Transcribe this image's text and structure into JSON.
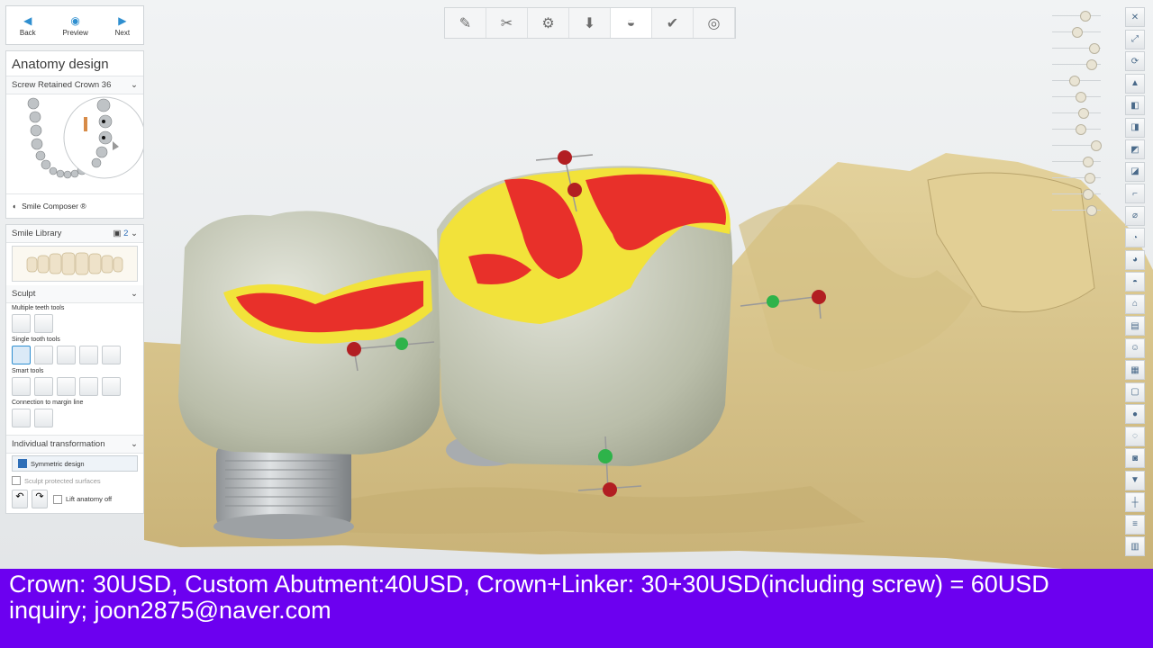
{
  "nav": {
    "back": "Back",
    "preview": "Preview",
    "next": "Next"
  },
  "panel": {
    "title": "Anatomy design",
    "restoration": "Screw Retained Crown 36",
    "smile_composer": "Smile Composer ®",
    "smile_library": "Smile Library",
    "library_badge": "2",
    "sculpt": "Sculpt",
    "multiple_tools": "Multiple teeth tools",
    "single_tools": "Single tooth tools",
    "smart_tools": "Smart tools",
    "connection": "Connection to margin line",
    "individual_transformation": "Individual transformation",
    "symmetric": "Symmetric design",
    "protected": "Sculpt protected surfaces",
    "lift_anatomy": "Lift anatomy off"
  },
  "top_toolbar": [
    "instrument-icon",
    "scissors-icon",
    "abutment-icon",
    "download-icon",
    "crown-icon",
    "check-crown-icon",
    "disc-icon"
  ],
  "right_slider_levels": [
    0.65,
    0.45,
    0.85,
    0.8,
    0.4,
    0.55,
    0.6,
    0.55,
    0.9,
    0.7,
    0.75,
    0.7,
    0.8
  ],
  "caption": {
    "line1": "Crown: 30USD, Custom Abutment:40USD, Crown+Linker: 30+30USD(including screw) = 60USD",
    "line2": "inquiry; joon2875@naver.com"
  },
  "colors": {
    "caption_bg": "#6c00f0",
    "accent": "#2f8fd0",
    "gum": "#dcc98f",
    "crown": "#c8ccbb",
    "contact_red": "#e8302a",
    "contact_yellow": "#f2e23a"
  }
}
